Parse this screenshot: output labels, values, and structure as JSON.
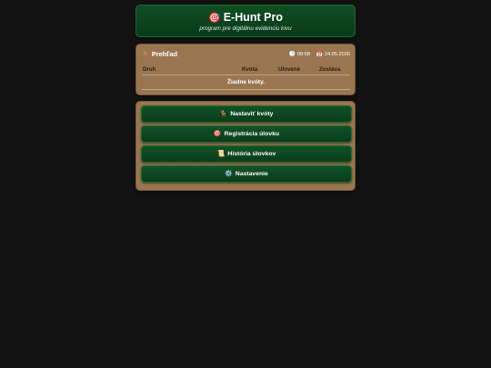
{
  "header": {
    "icon": "🎯",
    "title": "E-Hunt Pro",
    "subtitle": "program pre digitálnu evidenciu lovu"
  },
  "overview": {
    "icon": "🦌",
    "title": "Prehľad",
    "time_icon": "🕒",
    "time": "08:58",
    "date_icon": "📅",
    "date": "24.05.2026",
    "columns": [
      "Druh",
      "Kvóta",
      "Ulovené",
      "Zostáva"
    ],
    "empty_message": "Žiadne kvóty."
  },
  "actions": [
    {
      "icon": "🦌",
      "label": "Nastaviť kvóty"
    },
    {
      "icon": "🎯",
      "label": "Registrácia úlovku"
    },
    {
      "icon": "📜",
      "label": "História úlovkov"
    },
    {
      "icon": "⚙️",
      "label": "Nastavenie"
    }
  ],
  "colors": {
    "background": "#121212",
    "header_green": "#0f4f24",
    "panel_brown": "#9a7650",
    "button_green": "#105227"
  }
}
